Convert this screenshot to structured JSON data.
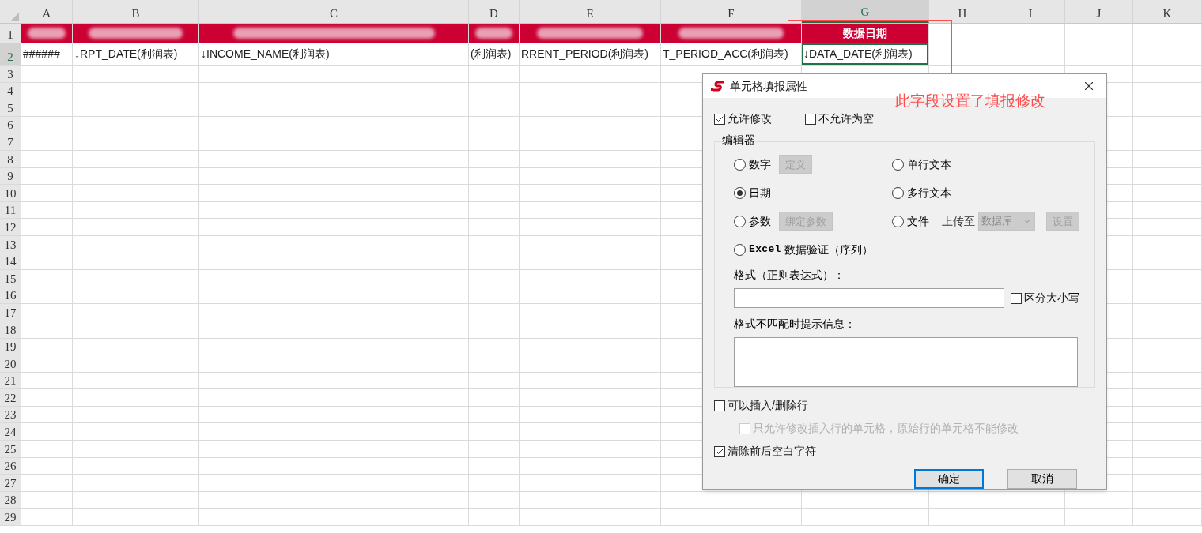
{
  "spreadsheet": {
    "columns": [
      {
        "label": "A",
        "selected": false
      },
      {
        "label": "B",
        "selected": false
      },
      {
        "label": "C",
        "selected": false
      },
      {
        "label": "D",
        "selected": false
      },
      {
        "label": "E",
        "selected": false
      },
      {
        "label": "F",
        "selected": false
      },
      {
        "label": "G",
        "selected": true
      },
      {
        "label": "H",
        "selected": false
      },
      {
        "label": "I",
        "selected": false
      },
      {
        "label": "J",
        "selected": false
      },
      {
        "label": "K",
        "selected": false
      }
    ],
    "rows": [
      {
        "label": "1",
        "selected": false,
        "cells": [
          {
            "kind": "redacted"
          },
          {
            "kind": "redacted"
          },
          {
            "kind": "redacted"
          },
          {
            "kind": "redacted"
          },
          {
            "kind": "redacted"
          },
          {
            "kind": "redacted"
          },
          {
            "kind": "header",
            "text": "数据日期"
          }
        ]
      },
      {
        "label": "2",
        "selected": true,
        "cells": [
          {
            "kind": "text",
            "text": "######",
            "selected": false
          },
          {
            "kind": "text",
            "text": "↓RPT_DATE(利润表)",
            "selected": false
          },
          {
            "kind": "text",
            "text": "↓INCOME_NAME(利润表)",
            "selected": false
          },
          {
            "kind": "text",
            "text": "(利润表)",
            "selected": false
          },
          {
            "kind": "text",
            "text": "RRENT_PERIOD(利润表)",
            "selected": false
          },
          {
            "kind": "text",
            "text": "T_PERIOD_ACC(利润表)",
            "selected": false
          },
          {
            "kind": "text",
            "text": "↓DATA_DATE(利润表)",
            "selected": true
          }
        ]
      },
      {
        "label": "3",
        "selected": false
      },
      {
        "label": "4",
        "selected": false
      },
      {
        "label": "5",
        "selected": false
      },
      {
        "label": "6",
        "selected": false
      },
      {
        "label": "7",
        "selected": false
      },
      {
        "label": "8",
        "selected": false
      },
      {
        "label": "9",
        "selected": false
      },
      {
        "label": "10",
        "selected": false
      },
      {
        "label": "11",
        "selected": false
      },
      {
        "label": "12",
        "selected": false
      },
      {
        "label": "13",
        "selected": false
      },
      {
        "label": "14",
        "selected": false
      },
      {
        "label": "15",
        "selected": false
      },
      {
        "label": "16",
        "selected": false
      },
      {
        "label": "17",
        "selected": false
      },
      {
        "label": "18",
        "selected": false
      },
      {
        "label": "19",
        "selected": false
      },
      {
        "label": "20",
        "selected": false
      },
      {
        "label": "21",
        "selected": false
      },
      {
        "label": "22",
        "selected": false
      },
      {
        "label": "23",
        "selected": false
      },
      {
        "label": "24",
        "selected": false
      },
      {
        "label": "25",
        "selected": false
      },
      {
        "label": "26",
        "selected": false
      },
      {
        "label": "27",
        "selected": false
      },
      {
        "label": "28",
        "selected": false
      },
      {
        "label": "29",
        "selected": false
      }
    ]
  },
  "annotation": {
    "text": "此字段设置了填报修改"
  },
  "dialog": {
    "title": "单元格填报属性",
    "top_checks": [
      {
        "label": "允许修改",
        "checked": true
      },
      {
        "label": "不允许为空",
        "checked": false
      }
    ],
    "editor_group": {
      "title": "编辑器",
      "rows": [
        [
          {
            "label": "数字",
            "selected": false,
            "button": {
              "label": "定义",
              "disabled": true
            }
          },
          {
            "label": "单行文本",
            "selected": false
          }
        ],
        [
          {
            "label": "日期",
            "selected": true
          },
          {
            "label": "多行文本",
            "selected": false
          }
        ],
        [
          {
            "label": "参数",
            "selected": false,
            "button": {
              "label": "绑定参数",
              "disabled": true
            }
          },
          {
            "label": "文件",
            "selected": false,
            "upload_label": "上传至",
            "dropdown": {
              "value": "数据库",
              "disabled": true
            },
            "button": {
              "label": "设置",
              "disabled": true
            }
          }
        ],
        [
          {
            "label": "数据验证（序列）",
            "prefix": "Excel",
            "selected": false
          }
        ]
      ],
      "format_label": "格式（正则表达式）：",
      "case_check": {
        "label": "区分大小写",
        "checked": false
      },
      "message_label": "格式不匹配时提示信息："
    },
    "bottom_checks": [
      {
        "label": "可以插入/删除行",
        "checked": false,
        "disabled": false,
        "indented": false
      },
      {
        "label": "只允许修改插入行的单元格，原始行的单元格不能修改",
        "checked": false,
        "disabled": true,
        "indented": true
      },
      {
        "label": "清除前后空白字符",
        "checked": true,
        "disabled": false,
        "indented": false
      }
    ],
    "buttons": [
      {
        "label": "确定",
        "default": true
      },
      {
        "label": "取消",
        "default": false
      }
    ]
  }
}
